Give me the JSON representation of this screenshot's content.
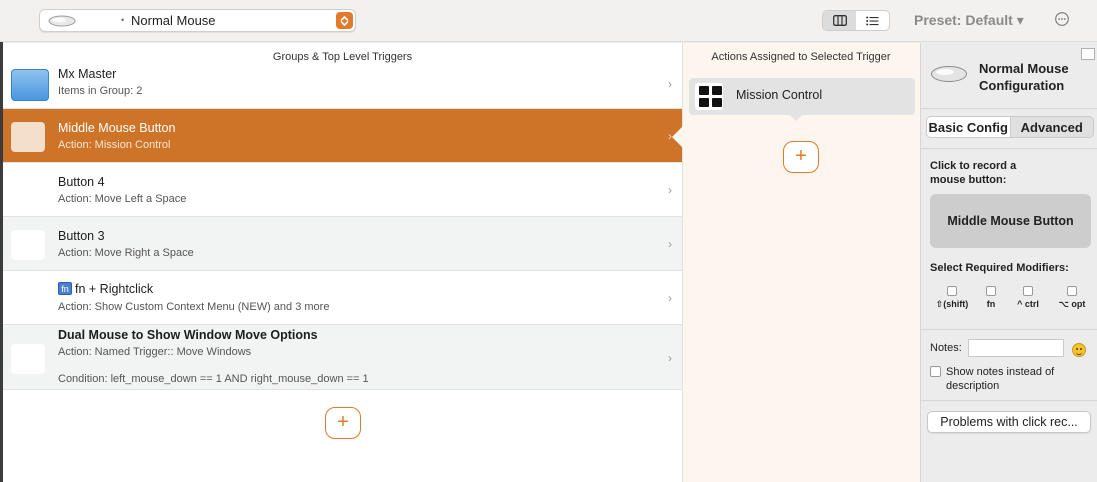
{
  "toolbar": {
    "device_dot": "•",
    "device_name": "Normal Mouse",
    "preset_label": "Preset: Default ▾"
  },
  "headers": {
    "groups": "Groups & Top Level Triggers",
    "actions": "Actions Assigned to Selected Trigger"
  },
  "triggers": [
    {
      "title": "Mx Master",
      "subtitle": "Items in Group: 2",
      "chevron": "›"
    },
    {
      "title": "Middle Mouse Button",
      "subtitle": "Action: Mission Control",
      "chevron": "›"
    },
    {
      "title": "Button 4",
      "subtitle": "Action: Move Left a Space",
      "chevron": "›"
    },
    {
      "title": "Button 3",
      "subtitle": "Action: Move Right a Space",
      "chevron": "›"
    },
    {
      "title": "fn + Rightclick",
      "badge": "fn",
      "subtitle": "Action: Show Custom Context Menu (NEW) and 3 more",
      "chevron": "›"
    },
    {
      "title": "Dual Mouse to Show Window Move Options",
      "subtitle": "Action: Named Trigger:: Move Windows",
      "condition": "Condition: left_mouse_down == 1 AND right_mouse_down == 1",
      "chevron": "›"
    }
  ],
  "add_symbol": "+",
  "actions": [
    {
      "label": "Mission Control"
    }
  ],
  "config": {
    "title": "Normal Mouse Configuration",
    "tabs": [
      "Basic Config",
      "Advanced"
    ],
    "record_label": "Click to record a mouse button:",
    "record_button": "Middle Mouse Button",
    "modifiers_label": "Select Required Modifiers:",
    "modifiers": [
      "⇧(shift)",
      "fn",
      "^ ctrl",
      "⌥ opt"
    ],
    "notes_label": "Notes:",
    "notes_value": "",
    "show_notes_label": "Show notes instead of description",
    "problems_button": "Problems with click rec..."
  },
  "colors": {
    "accent": "#e3792b",
    "selected_row": "#cd7428"
  }
}
